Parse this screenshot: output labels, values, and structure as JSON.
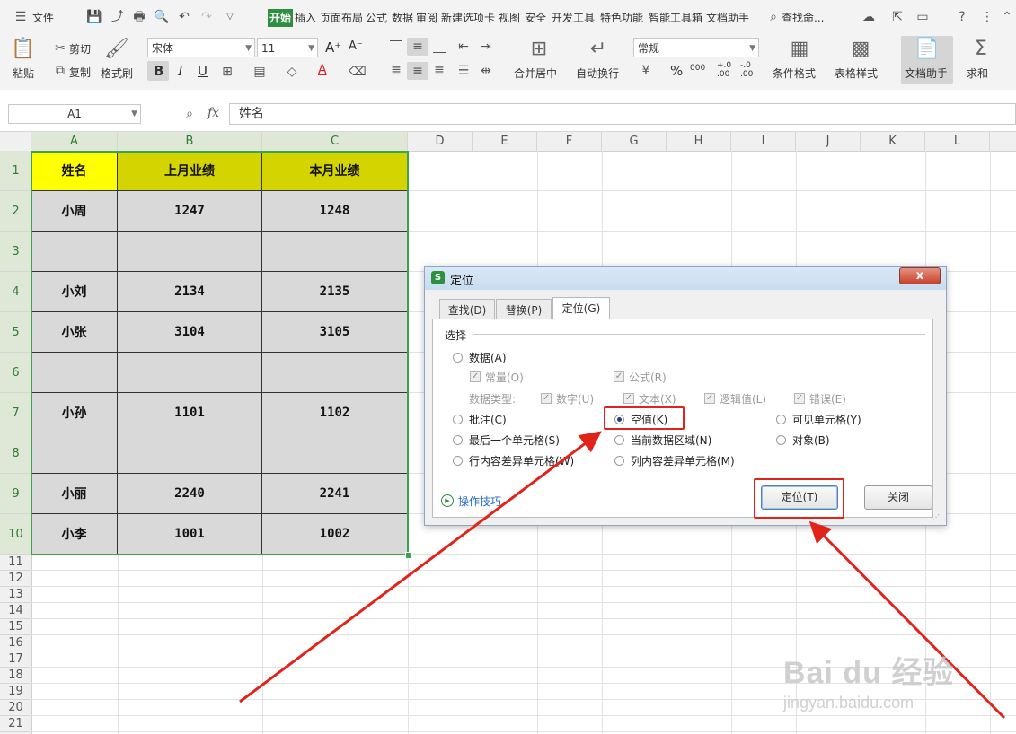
{
  "menubar": {
    "file": "文件",
    "tabs": [
      "开始",
      "插入",
      "页面布局",
      "公式",
      "数据",
      "审阅",
      "新建选项卡",
      "视图",
      "安全",
      "开发工具",
      "特色功能",
      "智能工具箱",
      "文档助手"
    ],
    "search": "查找命..."
  },
  "ribbon": {
    "paste": "粘贴",
    "cut": "剪切",
    "copy": "复制",
    "format_painter": "格式刷",
    "font_name": "宋体",
    "font_size": "11",
    "number_format": "常规",
    "merge_center": "合并居中",
    "wrap_text": "自动换行",
    "cond_format": "条件格式",
    "table_style": "表格样式",
    "doc_assistant": "文档助手",
    "sum": "求和",
    "bold": "B",
    "italic": "I",
    "underline": "U",
    "percent": "%",
    "font_color_glyph": "A",
    "grow_font": "A⁺",
    "shrink_font": "A⁻",
    "thousands": "000",
    "inc_decimal": "+.0\n.00",
    "dec_decimal": "-.0\n.00"
  },
  "formula_bar": {
    "name_box": "A1",
    "fx": "fx",
    "content": "姓名"
  },
  "columns": [
    "A",
    "B",
    "C",
    "D",
    "E",
    "F",
    "G",
    "H",
    "I",
    "J",
    "K",
    "L"
  ],
  "rows": [
    "1",
    "2",
    "3",
    "4",
    "5",
    "6",
    "7",
    "8",
    "9",
    "10",
    "11",
    "12",
    "13",
    "14",
    "15",
    "16",
    "17",
    "18",
    "19",
    "20",
    "21"
  ],
  "table": {
    "headers": [
      "姓名",
      "上月业绩",
      "本月业绩"
    ],
    "rows": [
      [
        "小周",
        "1247",
        "1248"
      ],
      [
        "",
        "",
        ""
      ],
      [
        "小刘",
        "2134",
        "2135"
      ],
      [
        "小张",
        "3104",
        "3105"
      ],
      [
        "",
        "",
        ""
      ],
      [
        "小孙",
        "1101",
        "1102"
      ],
      [
        "",
        "",
        ""
      ],
      [
        "小丽",
        "2240",
        "2241"
      ],
      [
        "小李",
        "1001",
        "1002"
      ]
    ]
  },
  "dialog": {
    "title": "定位",
    "close": "x",
    "tabs": [
      "查找(D)",
      "替换(P)",
      "定位(G)"
    ],
    "group": "选择",
    "data": "数据(A)",
    "constant": "常量(O)",
    "formula": "公式(R)",
    "data_type_label": "数据类型:",
    "number": "数字(U)",
    "text": "文本(X)",
    "logical": "逻辑值(L)",
    "error": "错误(E)",
    "comment": "批注(C)",
    "blank": "空值(K)",
    "visible": "可见单元格(Y)",
    "last_cell": "最后一个单元格(S)",
    "current_region": "当前数据区域(N)",
    "object": "对象(B)",
    "row_diff": "行内容差异单元格(W)",
    "col_diff": "列内容差异单元格(M)",
    "tips": "操作技巧",
    "ok": "定位(T)",
    "close_btn": "关闭"
  },
  "watermark": {
    "brand": "Bai du 经验",
    "url": "jingyan.baidu.com"
  },
  "colors": {
    "accent_green": "#2e8f3e",
    "header_yellow": "#ffff00",
    "header_olive": "#d4d400",
    "cell_gray": "#d9d9d9",
    "highlight_red": "#e2231a"
  }
}
